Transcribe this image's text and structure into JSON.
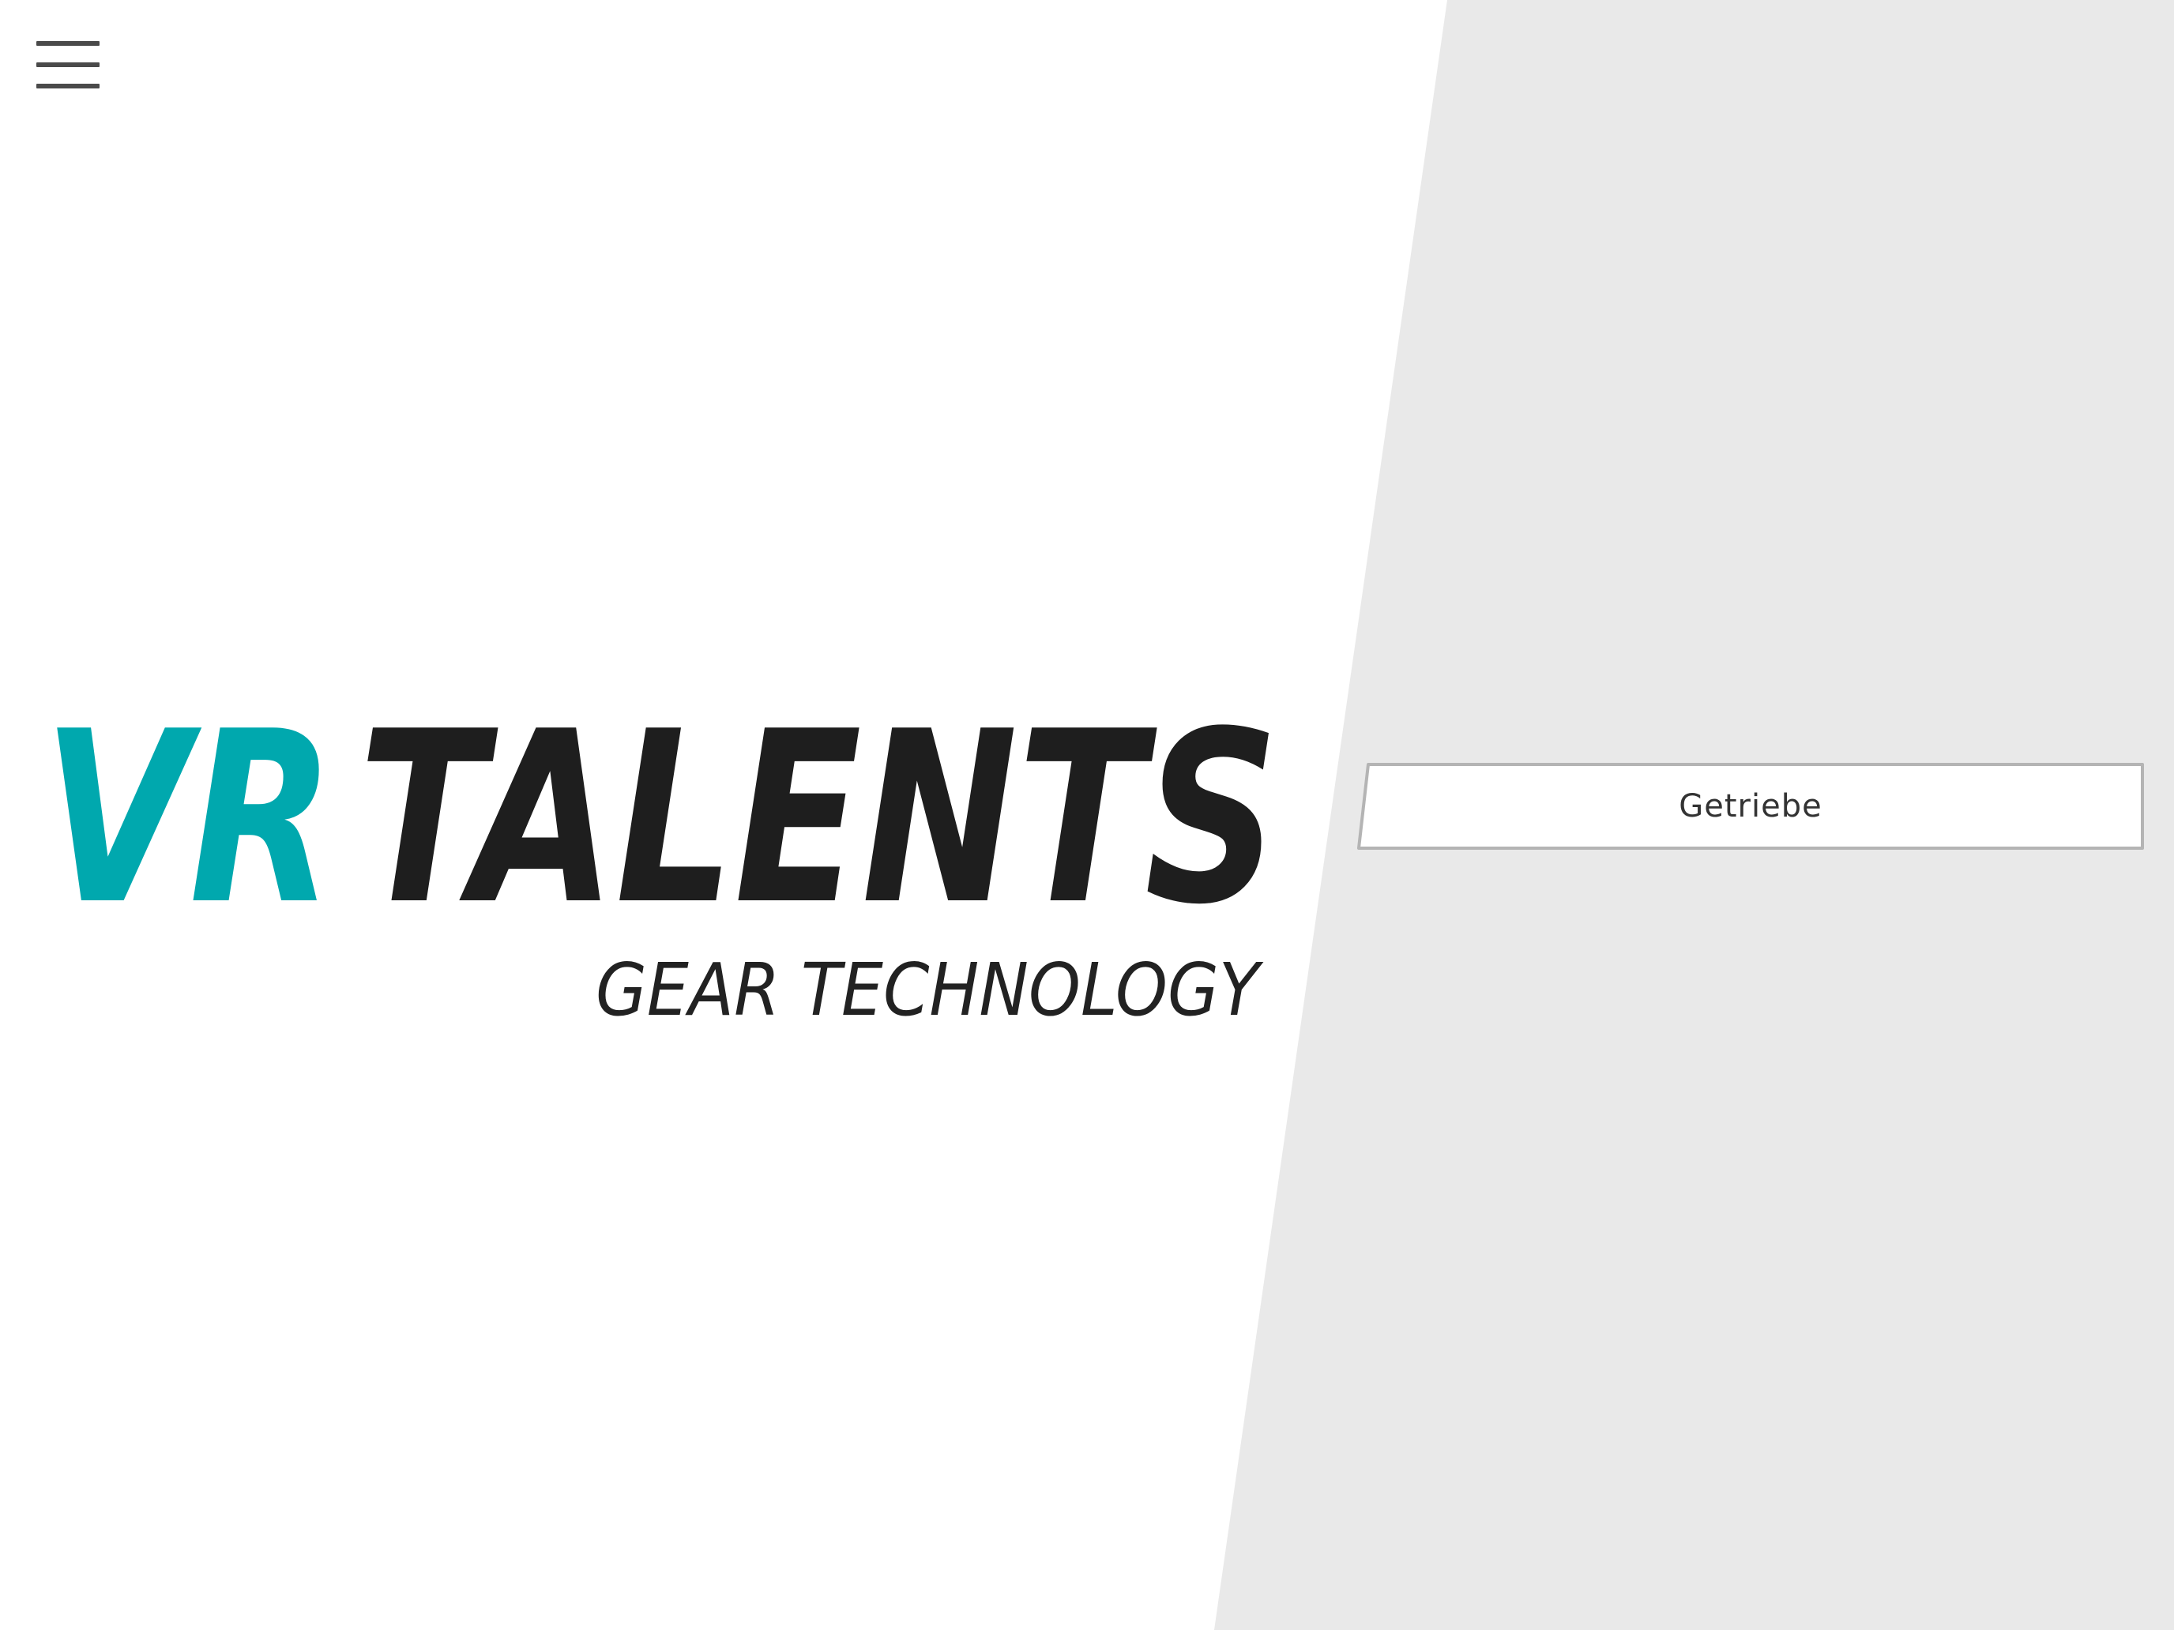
{
  "menu": {
    "icon": "hamburger-menu-icon"
  },
  "logo": {
    "brand_left": "VR",
    "brand_right": "TALENTS",
    "tagline": "GEAR TECHNOLOGY",
    "colors": {
      "accent": "#00a8ae",
      "dark": "#1e1e1e",
      "tagline": "#222222"
    }
  },
  "options": [
    {
      "label": "Getriebe"
    }
  ],
  "colors": {
    "background": "#ffffff",
    "panel": "#e9e9e9",
    "button_border": "#b4b4b4"
  }
}
